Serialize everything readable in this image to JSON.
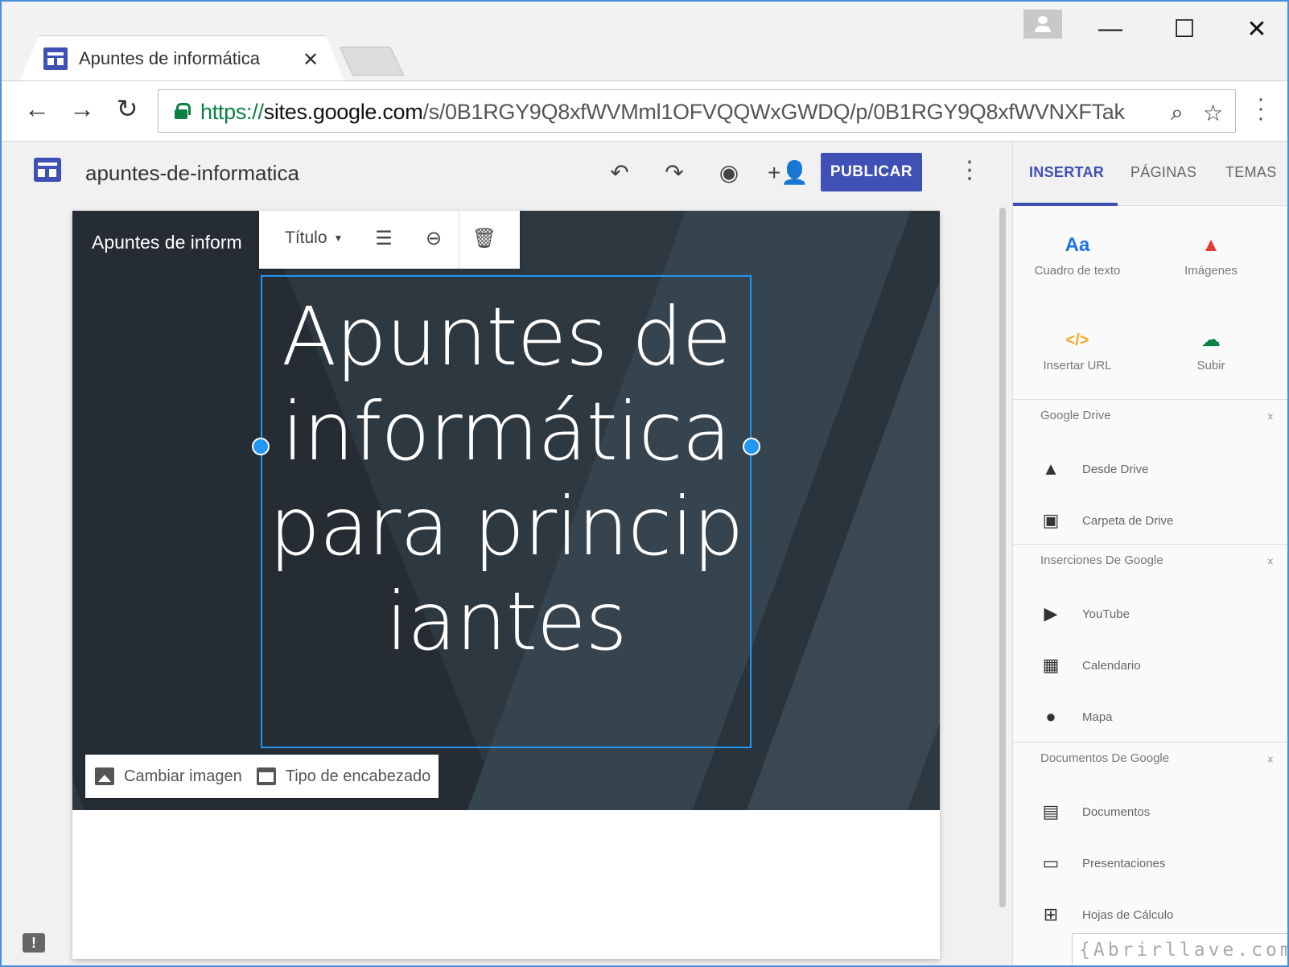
{
  "browser": {
    "tab_title": "Apuntes de informática",
    "tab_close": "✕",
    "url_https": "https://",
    "url_host": "sites.google.com",
    "url_path": "/s/0B1RGY9Q8xfWVMml1OFVQQWxGWDQ/p/0B1RGY9Q8xfWVNXFTak",
    "window_controls": {
      "minimize": "—",
      "maximize": "☐",
      "close": "✕"
    }
  },
  "sites_header": {
    "site_name": "apuntes-de-informatica",
    "publish_label": "PUBLICAR"
  },
  "banner": {
    "site_title": "Apuntes de inform",
    "heading": "Apuntes de informática para principiantes",
    "text_style": "Título",
    "change_image_label": "Cambiar imagen",
    "header_type_label": "Tipo de encabezado"
  },
  "panel": {
    "tabs": [
      "INSERTAR",
      "PÁGINAS",
      "TEMAS"
    ],
    "insert_items": [
      {
        "label": "Cuadro de texto",
        "icon": "text-box-icon",
        "glyph": "Aa",
        "color": "#1a73e8"
      },
      {
        "label": "Imágenes",
        "icon": "image-icon",
        "glyph": "▲",
        "color": "#e53935"
      },
      {
        "label": "Insertar URL",
        "icon": "embed-code-icon",
        "glyph": "</>",
        "color": "#f9a825"
      },
      {
        "label": "Subir",
        "icon": "cloud-upload-icon",
        "glyph": "☁",
        "color": "#0b8043"
      }
    ],
    "sections": [
      {
        "title": "Google Drive",
        "items": [
          "Desde Drive",
          "Carpeta de Drive"
        ]
      },
      {
        "title": "Inserciones De Google",
        "items": [
          "YouTube",
          "Calendario",
          "Mapa"
        ]
      },
      {
        "title": "Documentos De Google",
        "items": [
          "Documentos",
          "Presentaciones",
          "Hojas de Cálculo"
        ]
      }
    ]
  },
  "watermark": "{Abrirllave.com"
}
